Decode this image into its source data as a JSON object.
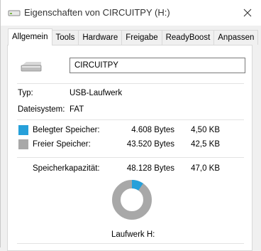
{
  "window": {
    "title": "Eigenschaften von CIRCUITPY (H:)"
  },
  "tabs": [
    {
      "label": "Allgemein",
      "active": true
    },
    {
      "label": "Tools"
    },
    {
      "label": "Hardware"
    },
    {
      "label": "Freigabe"
    },
    {
      "label": "ReadyBoost"
    },
    {
      "label": "Anpassen"
    }
  ],
  "general": {
    "drive_name": "CIRCUITPY",
    "type_label": "Typ:",
    "type_value": "USB-Laufwerk",
    "fs_label": "Dateisystem:",
    "fs_value": "FAT"
  },
  "storage": {
    "used": {
      "label": "Belegter Speicher:",
      "bytes": "4.608 Bytes",
      "size": "4,50 KB",
      "color": "#26a0da"
    },
    "free": {
      "label": "Freier Speicher:",
      "bytes": "43.520 Bytes",
      "size": "42,5 KB",
      "color": "#a8a8a8"
    },
    "capacity": {
      "label": "Speicherkapazität:",
      "bytes": "48.128 Bytes",
      "size": "47,0 KB"
    },
    "used_fraction": 0.0957,
    "drive_label": "Laufwerk H:"
  }
}
